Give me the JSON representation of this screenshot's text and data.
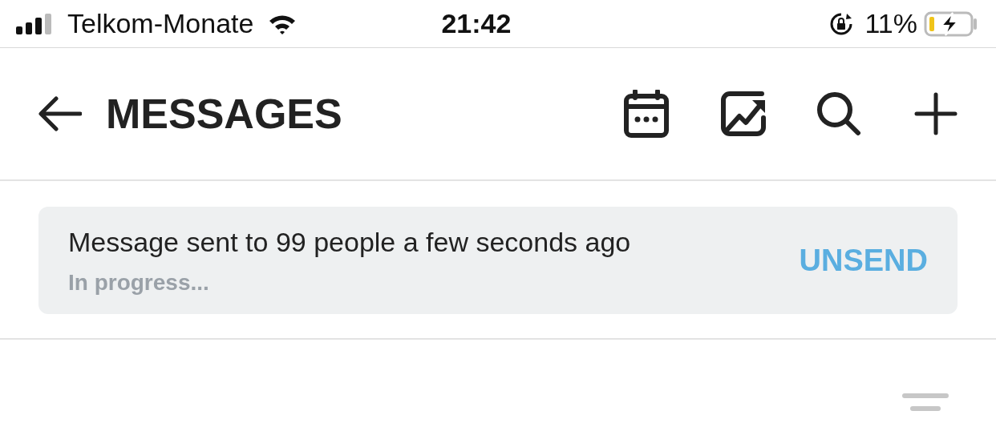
{
  "status_bar": {
    "carrier": "Telkom-Monate",
    "time": "21:42",
    "battery_percent": "11%"
  },
  "header": {
    "title": "MESSAGES"
  },
  "notice": {
    "message": "Message sent to 99 people a few seconds ago",
    "status": "In progress...",
    "action": "UNSEND"
  }
}
